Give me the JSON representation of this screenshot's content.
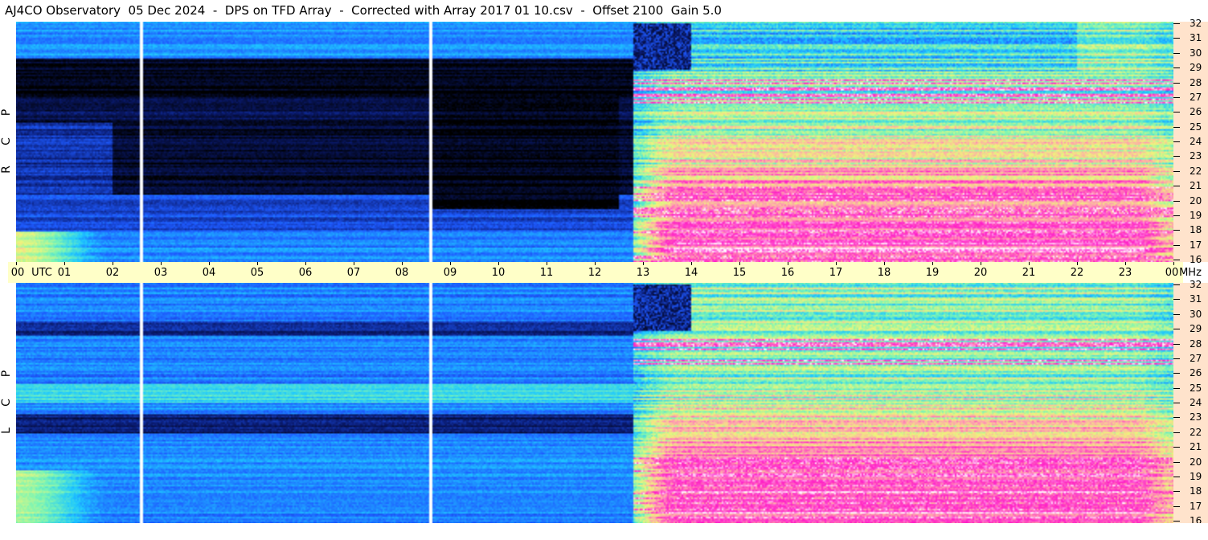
{
  "title": "AJ4CO Observatory  05 Dec 2024  -  DPS on TFD Array  -  Corrected with Array 2017 01 10.csv  -  Offset 2100  Gain 5.0",
  "chart_data": {
    "type": "heatmap",
    "panels": [
      {
        "label": [
          "R",
          "C",
          "P"
        ],
        "name": "RCP"
      },
      {
        "label": [
          "L",
          "C",
          "P"
        ],
        "name": "LCP"
      }
    ],
    "x_unit_label": "UTC",
    "x_ticks": [
      "00",
      "01",
      "02",
      "03",
      "04",
      "05",
      "06",
      "07",
      "08",
      "09",
      "10",
      "11",
      "12",
      "13",
      "14",
      "15",
      "16",
      "17",
      "18",
      "19",
      "20",
      "21",
      "22",
      "23",
      "00"
    ],
    "xlim": [
      0,
      24
    ],
    "y_unit_label": "MHz",
    "y_ticks": [
      "16",
      "17",
      "18",
      "19",
      "20",
      "21",
      "22",
      "23",
      "24",
      "25",
      "26",
      "27",
      "28",
      "29",
      "30",
      "31",
      "32"
    ],
    "ylim": [
      16,
      32
    ],
    "colormap": [
      "#000000",
      "#0a1a6e",
      "#1e5aff",
      "#1ec8ff",
      "#7cf5b4",
      "#f0f57a",
      "#ff9fb0",
      "#ff1ec8",
      "#ffffff"
    ]
  },
  "colors": {
    "axis_band": "#ffffc8",
    "right_axis": "#ffe3cc"
  }
}
